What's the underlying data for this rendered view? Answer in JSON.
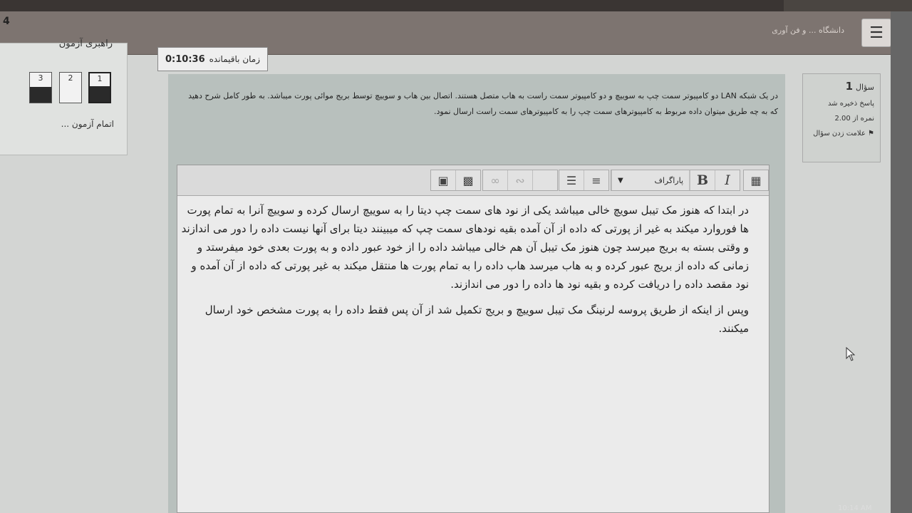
{
  "navbar": {
    "site_name": "دانشگاه ... و فن آوری",
    "menu_icon": "hamburger-icon",
    "left_glyph": "4"
  },
  "quiz_navigation": {
    "title": "راهبری آزمون",
    "questions": [
      {
        "number": "3",
        "answered": true
      },
      {
        "number": "2",
        "answered": false
      },
      {
        "number": "1",
        "answered": true,
        "current": true
      }
    ],
    "finish_link": "اتمام آزمون ..."
  },
  "timer": {
    "label": "زمان باقیمانده",
    "value": "0:10:36"
  },
  "question_info": {
    "label": "سؤال",
    "number": "1",
    "status": "پاسخ ذخیره شد",
    "mark": "نمره از 2.00",
    "flag": "علامت زدن سؤال",
    "flag_icon": "flag-icon"
  },
  "question": {
    "text": "در یک شبکه LAN دو کامپیوتر سمت چپ به سوییچ و دو کامپیوتر سمت راست به هاب متصل هستند. اتصال بین هاب و سوییچ توسط بریج موائی پورت میباشد. به طور کامل شرح دهید که به چه طریق میتوان داده مربوط به کامپیوترهای سمت چپ را به کامپیوترهای سمت راست ارسال نمود."
  },
  "editor": {
    "toolbar": {
      "paragraph_label": "پاراگراف",
      "icons": [
        "keyboard-icon",
        "dropdown-caret-icon",
        "bold-icon",
        "italic-icon",
        "bullet-list-icon",
        "numbered-list-icon",
        "link-icon",
        "unlink-icon",
        "blank-icon",
        "image-icon",
        "video-icon"
      ]
    },
    "answer": [
      "در ابتدا که هنوز مک تیبل سویچ خالی میباشد یکی از نود های سمت چپ دیتا را به سوییچ ارسال کرده و سوییچ آنرا به تمام پورت ها فوروارد میکند به غیر از پورتی که داده از آن آمده بقیه نودهای سمت چپ که میبینند دیتا برای آنها نیست داده را دور می اندازند و وقتی بسته به بریج میرسد چون هنوز مک تیبل آن هم خالی میباشد داده را از خود عبور داده و به پورت بعدی خود میفرستد و زمانی که داده از بریج عبور کرده و به هاب میرسد هاب داده را به تمام پورت ها منتقل میکند به غیر پورتی که داده از آن آمده و نود مقصد داده را دریافت کرده و بقیه نود ها داده را دور می اندازند.",
      "وپس از اینکه از طریق پروسه لرنینگ مک تیبل سوییچ و بریج تکمیل شد از آن پس فقط داده را به پورت مشخص خود ارسال میکنند."
    ]
  },
  "taskbar": {
    "clock": "10:14 AM"
  }
}
